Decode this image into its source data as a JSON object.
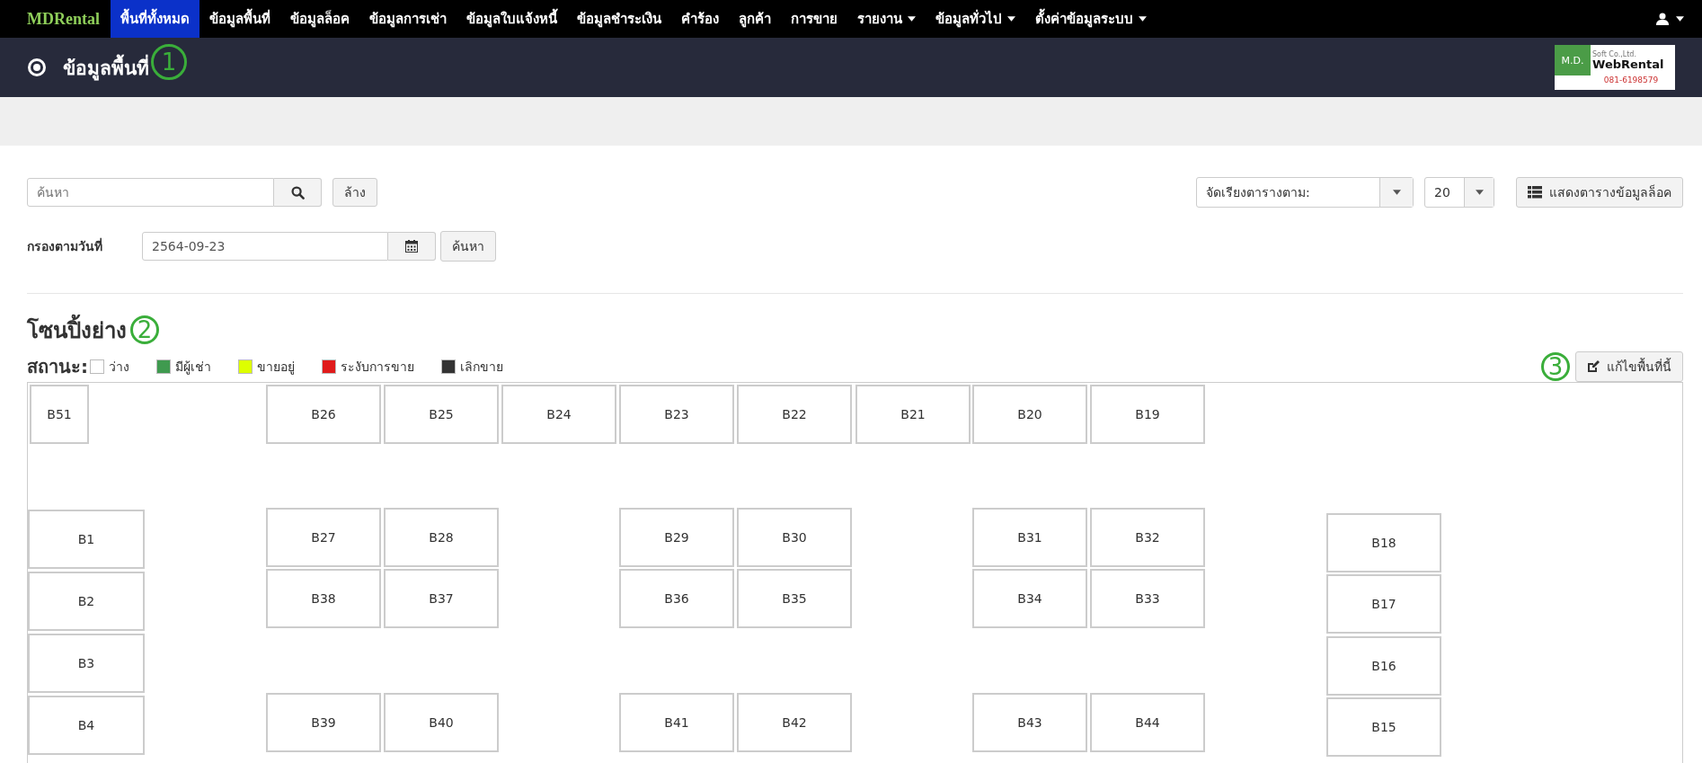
{
  "navbar": {
    "brand": "MDRental",
    "items": [
      {
        "label": "พื้นที่ทั้งหมด",
        "selected": true,
        "has_menu": false
      },
      {
        "label": "ข้อมูลพื้นที่",
        "selected": false,
        "has_menu": false
      },
      {
        "label": "ข้อมูลล็อค",
        "selected": false,
        "has_menu": false
      },
      {
        "label": "ข้อมูลการเช่า",
        "selected": false,
        "has_menu": false
      },
      {
        "label": "ข้อมูลใบแจ้งหนี้",
        "selected": false,
        "has_menu": false
      },
      {
        "label": "ข้อมูลชำระเงิน",
        "selected": false,
        "has_menu": false
      },
      {
        "label": "คำร้อง",
        "selected": false,
        "has_menu": false
      },
      {
        "label": "ลูกค้า",
        "selected": false,
        "has_menu": false
      },
      {
        "label": "การขาย",
        "selected": false,
        "has_menu": false
      },
      {
        "label": "รายงาน",
        "selected": false,
        "has_menu": true
      },
      {
        "label": "ข้อมูลทั่วไป",
        "selected": false,
        "has_menu": true
      },
      {
        "label": "ตั้งค่าข้อมูลระบบ",
        "selected": false,
        "has_menu": true
      }
    ]
  },
  "header": {
    "title": "ข้อมูลพื้นที่",
    "annotation": "1",
    "logo": {
      "left": "M.D.",
      "right": "WebRental",
      "small": "Soft Co.,Ltd.",
      "phone": "081-6198579"
    }
  },
  "filters": {
    "search": {
      "placeholder": "ค้นหา"
    },
    "clear_button": "ล้าง",
    "sort_select": "จัดเรียงตารางตาม:",
    "page_size": "20",
    "table_button": "แสดงตารางข้อมูลล็อค",
    "date_label": "กรองตามวันที่",
    "date_value": "2564-09-23",
    "date_search_button": "ค้นหา"
  },
  "zone": {
    "title": "โซนปิ้งย่าง",
    "annotation": "2",
    "status_label": "สถานะ:",
    "legend": [
      {
        "label": "ว่าง",
        "color": "#ffffff"
      },
      {
        "label": "มีผู้เช่า",
        "color": "#3f9a4f"
      },
      {
        "label": "ขายอยู่",
        "color": "#ddff00"
      },
      {
        "label": "ระงับการขาย",
        "color": "#e01b1b"
      },
      {
        "label": "เลิกขาย",
        "color": "#333333"
      }
    ],
    "edit_button": "แก้ไขพื้นที่นี้",
    "edit_annotation": "3",
    "plots": [
      "B51",
      "B26",
      "B25",
      "B24",
      "B23",
      "B22",
      "B21",
      "B20",
      "B19",
      "B1",
      "B27",
      "B28",
      "B29",
      "B30",
      "B31",
      "B32",
      "B18",
      "B2",
      "B38",
      "B37",
      "B36",
      "B35",
      "B34",
      "B33",
      "B17",
      "B3",
      "B16",
      "B4",
      "B39",
      "B40",
      "B41",
      "B42",
      "B43",
      "B44",
      "B15"
    ]
  }
}
